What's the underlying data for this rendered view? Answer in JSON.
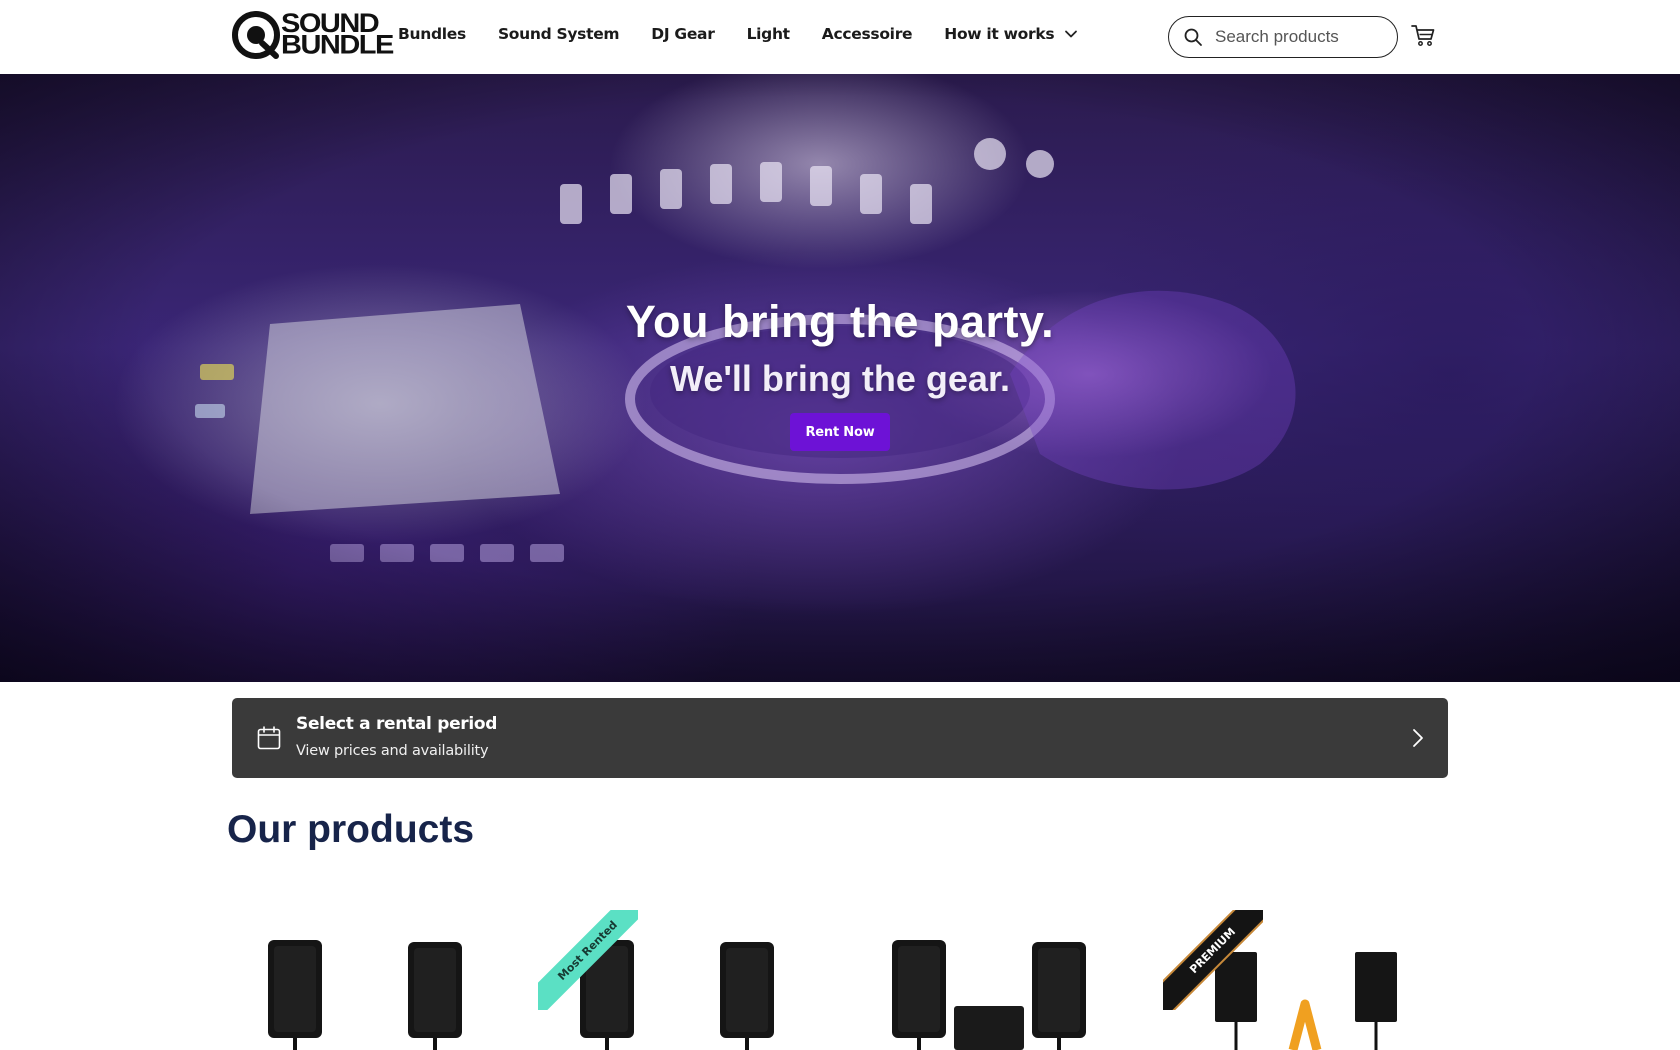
{
  "brand": {
    "logo_line1": "SOUND",
    "logo_line2": "BUNDLE"
  },
  "nav": {
    "items": [
      {
        "label": "Bundles"
      },
      {
        "label": "Sound System"
      },
      {
        "label": "DJ Gear"
      },
      {
        "label": "Light"
      },
      {
        "label": "Accessoire"
      },
      {
        "label": "How it works"
      }
    ]
  },
  "search": {
    "placeholder": "Search products",
    "value": ""
  },
  "hero": {
    "title": "You bring the party.",
    "subtitle": "We'll bring the gear.",
    "cta_label": "Rent Now"
  },
  "rental_bar": {
    "title": "Select a rental period",
    "subtitle": "View prices and availability"
  },
  "products_section": {
    "title": "Our products",
    "items": [
      {
        "ribbon": ""
      },
      {
        "ribbon": "Most Rented"
      },
      {
        "ribbon": ""
      },
      {
        "ribbon": "PREMIUM"
      }
    ]
  },
  "colors": {
    "accent": "#6d12d6",
    "heading": "#17244a",
    "rental_bar": "#3a3a3a",
    "ribbon_green": "#5be0c4"
  },
  "icons": [
    "logo-q-icon",
    "chevron-down-icon",
    "search-icon",
    "cart-icon",
    "calendar-icon",
    "chevron-right-icon"
  ]
}
